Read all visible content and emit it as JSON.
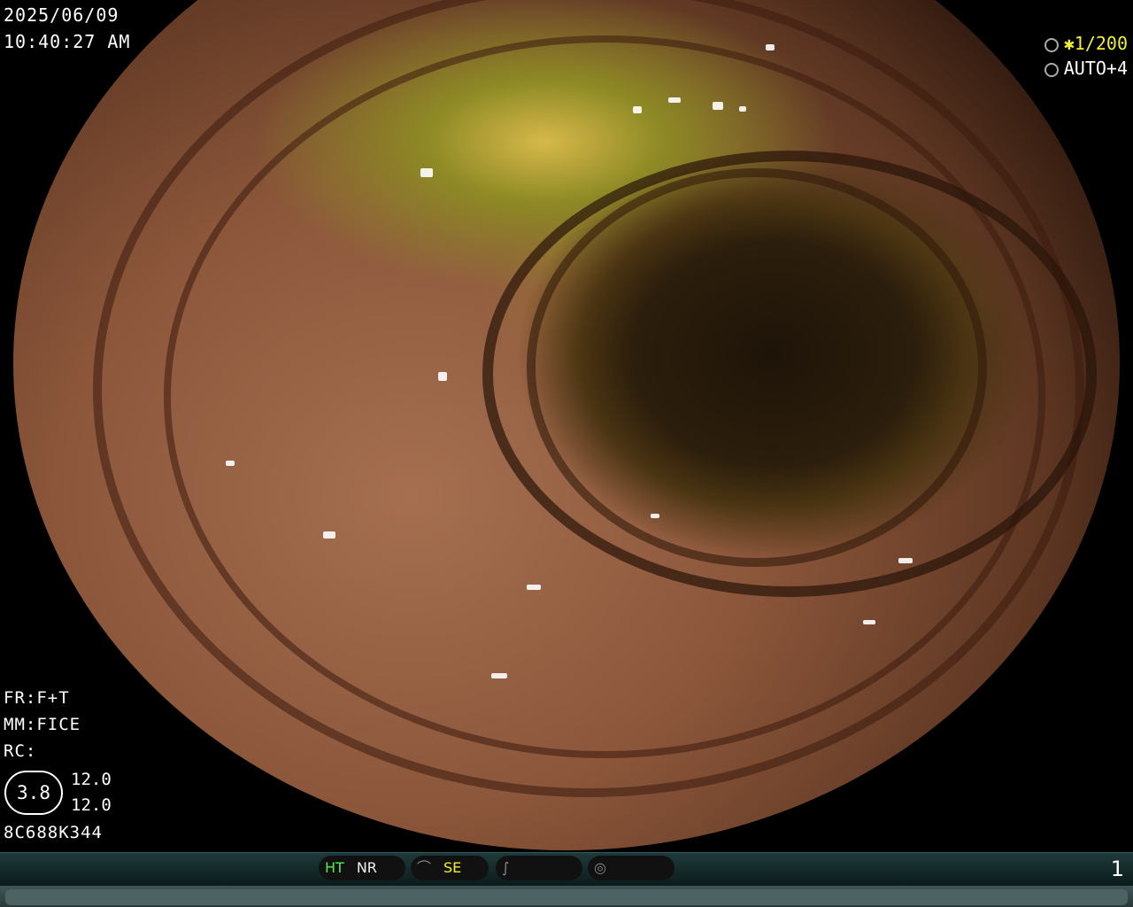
{
  "overlay": {
    "date": "2025/06/09",
    "time": "10:40:27  AM",
    "shutter": "✱1/200",
    "iris": "AUTO+4",
    "fr": "FR:F+T",
    "mm": "MM:FICE",
    "rc": "RC:",
    "structure": "3.8",
    "value1": "12.0",
    "value2": "12.0",
    "serial": "8C688K344"
  },
  "status": {
    "ht": "HT",
    "nr": "NR",
    "se": "SE",
    "page": "1"
  },
  "colors": {
    "ht": "#4ef04e",
    "se": "#f0f030",
    "shutter": "#f0f030"
  },
  "icons": [
    "shutter-icon",
    "iris-icon",
    "wave-icon",
    "curve-icon",
    "circle-wave-icon"
  ]
}
